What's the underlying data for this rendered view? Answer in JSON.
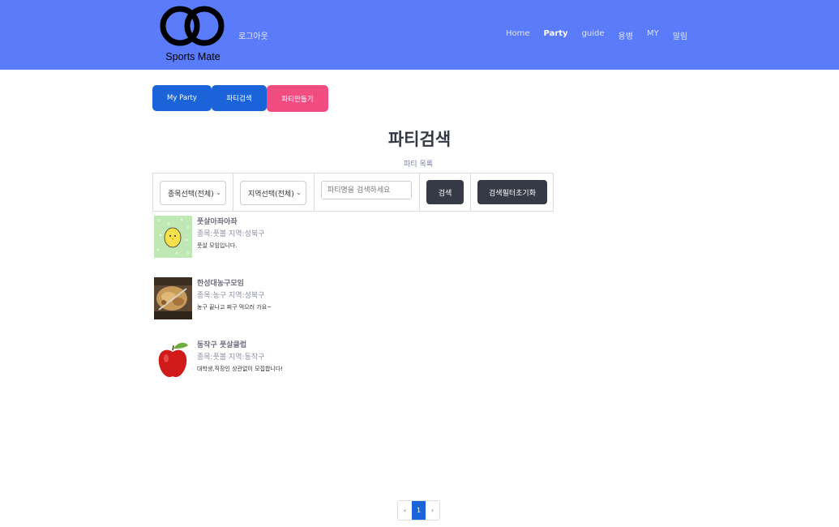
{
  "header": {
    "logo_text": "Sports Mate",
    "logout": "로그아웃",
    "nav": [
      "Home",
      "Party",
      "guide",
      "용병",
      "MY",
      "알림"
    ],
    "active": "Party"
  },
  "tabs": {
    "my_party": "My Party",
    "party_search": "파티검색",
    "party_create": "파티만들기"
  },
  "page": {
    "title": "파티검색",
    "subtitle": "파티 목록"
  },
  "filters": {
    "sport_select": "종목선택(전체)",
    "region_select": "지역선택(전체)",
    "search_placeholder": "파티명을 검색하세요",
    "search_button": "검색",
    "reset_button": "검색필터초기화"
  },
  "parties": [
    {
      "name": "풋살아좌아좌",
      "meta": "종목:풋볼 지역:성북구",
      "desc": "풋살 모임입니다.",
      "thumb": "chick-icon"
    },
    {
      "name": "한성대농구모임",
      "meta": "종목:농구 지역:성북구",
      "desc": "농구 끝나고 찌구 먹으러 가요~",
      "thumb": "food-photo"
    },
    {
      "name": "동작구 풋살클럽",
      "meta": "종목:풋볼 지역:동작구",
      "desc": "대학생,직장인 상관없이 모집합니다!",
      "thumb": "apple-icon"
    }
  ],
  "pagination": {
    "prev": "‹",
    "current": "1",
    "next": "›"
  },
  "colors": {
    "navbar": "#5b7cfa",
    "primary": "#1a63d8",
    "pink": "#f24d83",
    "dark_button": "#353a46"
  }
}
